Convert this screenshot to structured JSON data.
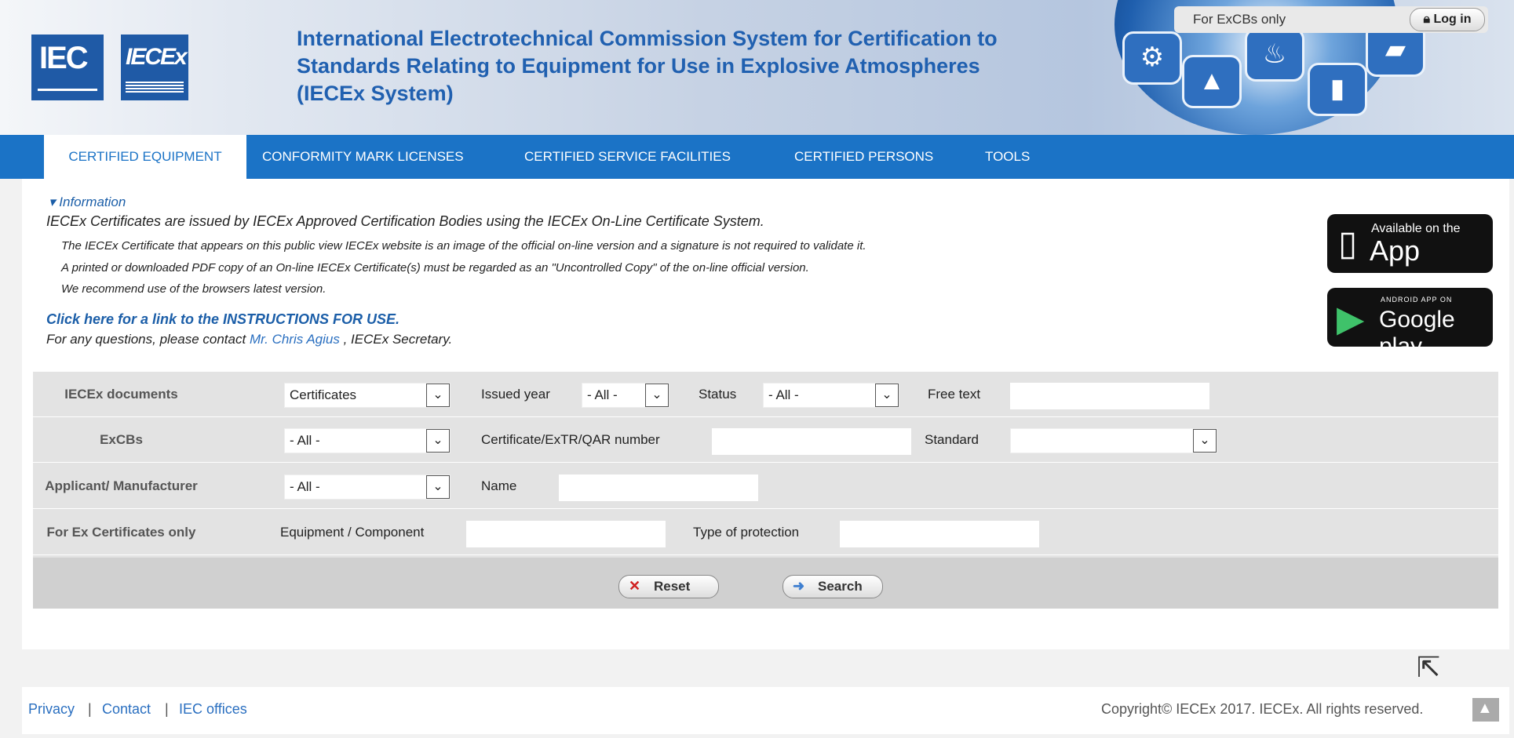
{
  "header": {
    "logo_iec": "IEC",
    "logo_iecex": "IECEx",
    "title_lines": [
      "International Electrotechnical Commission System for Certification to",
      "Standards Relating to Equipment for Use in Explosive Atmospheres",
      "(IECEx System)"
    ],
    "excb_label": "For ExCBs only",
    "login_label": "Log in",
    "login_icon": "lock-icon"
  },
  "nav": {
    "items": [
      "CERTIFIED EQUIPMENT",
      "CONFORMITY MARK LICENSES",
      "CERTIFIED SERVICE FACILITIES",
      "CERTIFIED PERSONS",
      "TOOLS"
    ],
    "active": "CERTIFIED EQUIPMENT"
  },
  "info": {
    "toggle_label": "Information",
    "lines": [
      "IECEx Certificates are issued by IECEx Approved Certification Bodies using the IECEx On-Line Certificate System.",
      "The IECEx Certificate that appears on this public view IECEx website is an image of the official on-line version and a signature is not required to validate it.",
      "A printed or downloaded PDF copy of an On-line IECEx Certificate(s) must be regarded as an \"Uncontrolled Copy\" of the on-line official version.",
      "We recommend use of the browsers latest version."
    ],
    "instructions_link": "Click here for a link to the INSTRUCTIONS FOR USE.",
    "contact_prefix": "For any questions, please contact",
    "contact_name": "Mr. Chris Agius",
    "contact_suffix": ", IECEx Secretary."
  },
  "badges": {
    "appstore_small": "Available on the",
    "appstore_big": "App Store",
    "gplay_small": "ANDROID APP ON",
    "gplay_big": "Google play"
  },
  "form": {
    "row1": {
      "label": "IECEx documents",
      "documents_value": "Certificates",
      "issued_year_label": "Issued year",
      "issued_year_value": "- All -",
      "status_label": "Status",
      "status_value": "- All -",
      "free_text_label": "Free text",
      "free_text_value": ""
    },
    "row2": {
      "label": "ExCBs",
      "excbs_value": "- All -",
      "cert_number_label": "Certificate/ExTR/QAR number",
      "cert_number_value": "",
      "standard_label": "Standard",
      "standard_value": ""
    },
    "row3": {
      "label": "Applicant/ Manufacturer",
      "applicant_value": "- All -",
      "name_label": "Name",
      "name_value": ""
    },
    "row4": {
      "label": "For Ex Certificates only",
      "equipment_label": "Equipment / Component",
      "equipment_value": "",
      "protection_label": "Type of protection",
      "protection_value": ""
    },
    "reset_label": "Reset",
    "search_label": "Search"
  },
  "footer": {
    "links": [
      "Privacy",
      "Contact",
      "IEC offices"
    ],
    "separator": "|",
    "copyright": "Copyright© IECEx 2017. IECEx. All rights reserved."
  },
  "colors": {
    "nav_bg": "#1b73c6",
    "title": "#2060b0",
    "link": "#2a6fc0"
  }
}
